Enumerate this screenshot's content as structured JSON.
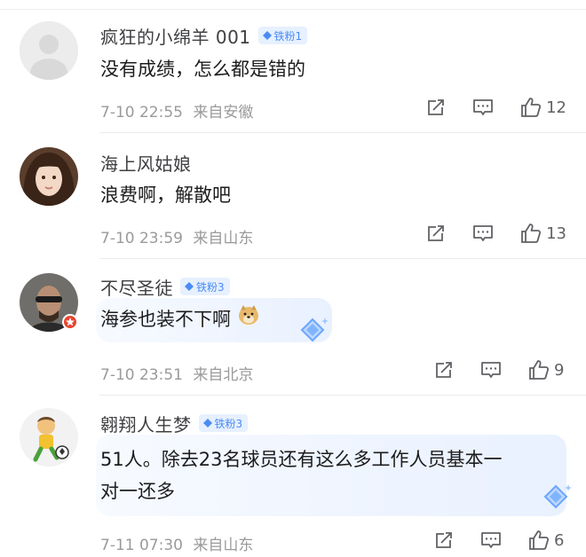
{
  "comments": [
    {
      "name": "疯狂的小绵羊 001",
      "fan_badge": "铁粉1",
      "text": "没有成绩，怎么都是错的",
      "time": "7-10 22:55",
      "location": "来自安徽",
      "likes": "12"
    },
    {
      "name": "海上风姑娘",
      "text": "浪费啊，解散吧",
      "time": "7-10 23:59",
      "location": "来自山东",
      "likes": "13"
    },
    {
      "name": "不尽圣徒",
      "fan_badge": "铁粉3",
      "text": "海参也装不下啊",
      "time": "7-10 23:51",
      "location": "来自北京",
      "likes": "9"
    },
    {
      "name": "翱翔人生梦",
      "fan_badge": "铁粉3",
      "text_line1": "51人。除去23名球员还有这么多工作人员基本一",
      "text_line2": "对一还多",
      "time": "7-11 07:30",
      "location": "来自山东",
      "likes": "6"
    }
  ],
  "icons": {
    "share": "share-icon",
    "reply": "comment-icon",
    "like": "thumbs-up-icon",
    "emoji": "doge-emoji-icon",
    "fan_badge": "diamond-icon",
    "verified": "verified-badge-icon"
  },
  "colors": {
    "fan_badge_bg": "#e6f0ff",
    "fan_badge_text": "#4a8cf5",
    "verified_badge": "#e8432f",
    "meta_text": "#9a9a9a"
  }
}
